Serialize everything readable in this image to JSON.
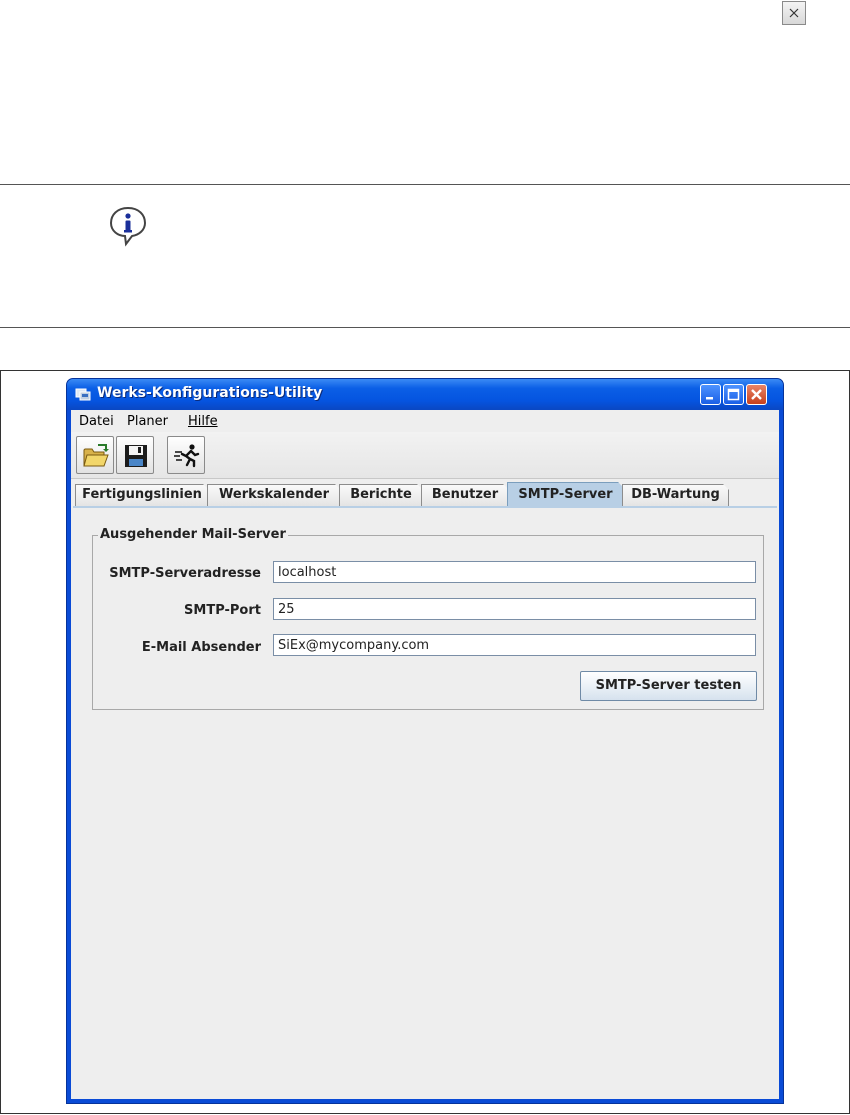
{
  "window": {
    "title": "Werks-Konfigurations-Utility"
  },
  "menu": [
    "Datei",
    "Planer",
    "Hilfe"
  ],
  "toolbar": {
    "icons": [
      "open-folder-icon",
      "save-disk-icon",
      "run-icon"
    ]
  },
  "tabs": [
    {
      "label": "Fertigungslinien",
      "active": false
    },
    {
      "label": "Werkskalender",
      "active": false
    },
    {
      "label": "Berichte",
      "active": false
    },
    {
      "label": "Benutzer",
      "active": false
    },
    {
      "label": "SMTP-Server",
      "active": true
    },
    {
      "label": "DB-Wartung",
      "active": false
    }
  ],
  "smtp": {
    "group_title": "Ausgehender Mail-Server",
    "fields": [
      {
        "label": "SMTP-Serveradresse",
        "value": "localhost"
      },
      {
        "label": "SMTP-Port",
        "value": "25"
      },
      {
        "label": "E-Mail Absender",
        "value": "SiEx@mycompany.com"
      }
    ],
    "test_button": "SMTP-Server testen"
  },
  "colors": {
    "titlebar": "#0554e0",
    "active_tab": "#b8cfe5",
    "panel_bg": "#eeeeee"
  }
}
